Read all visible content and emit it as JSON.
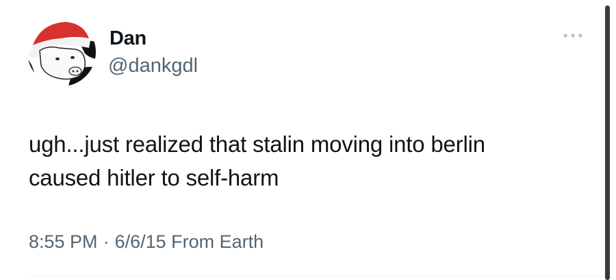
{
  "author": {
    "display_name": "Dan",
    "handle": "@dankgdl",
    "avatar_icon": "cow-santa-hat-avatar"
  },
  "tweet": {
    "text_line1": "ugh...just realized that stalin moving into berlin",
    "text_line2": "caused hitler to self-harm"
  },
  "meta": {
    "time": "8:55 PM",
    "separator": "·",
    "date": "6/6/15",
    "source": "From Earth"
  },
  "menu_icon": "more-options-icon",
  "colors": {
    "primary_text": "#0f1419",
    "secondary_text": "#536471",
    "hat_red": "#d8322f"
  }
}
